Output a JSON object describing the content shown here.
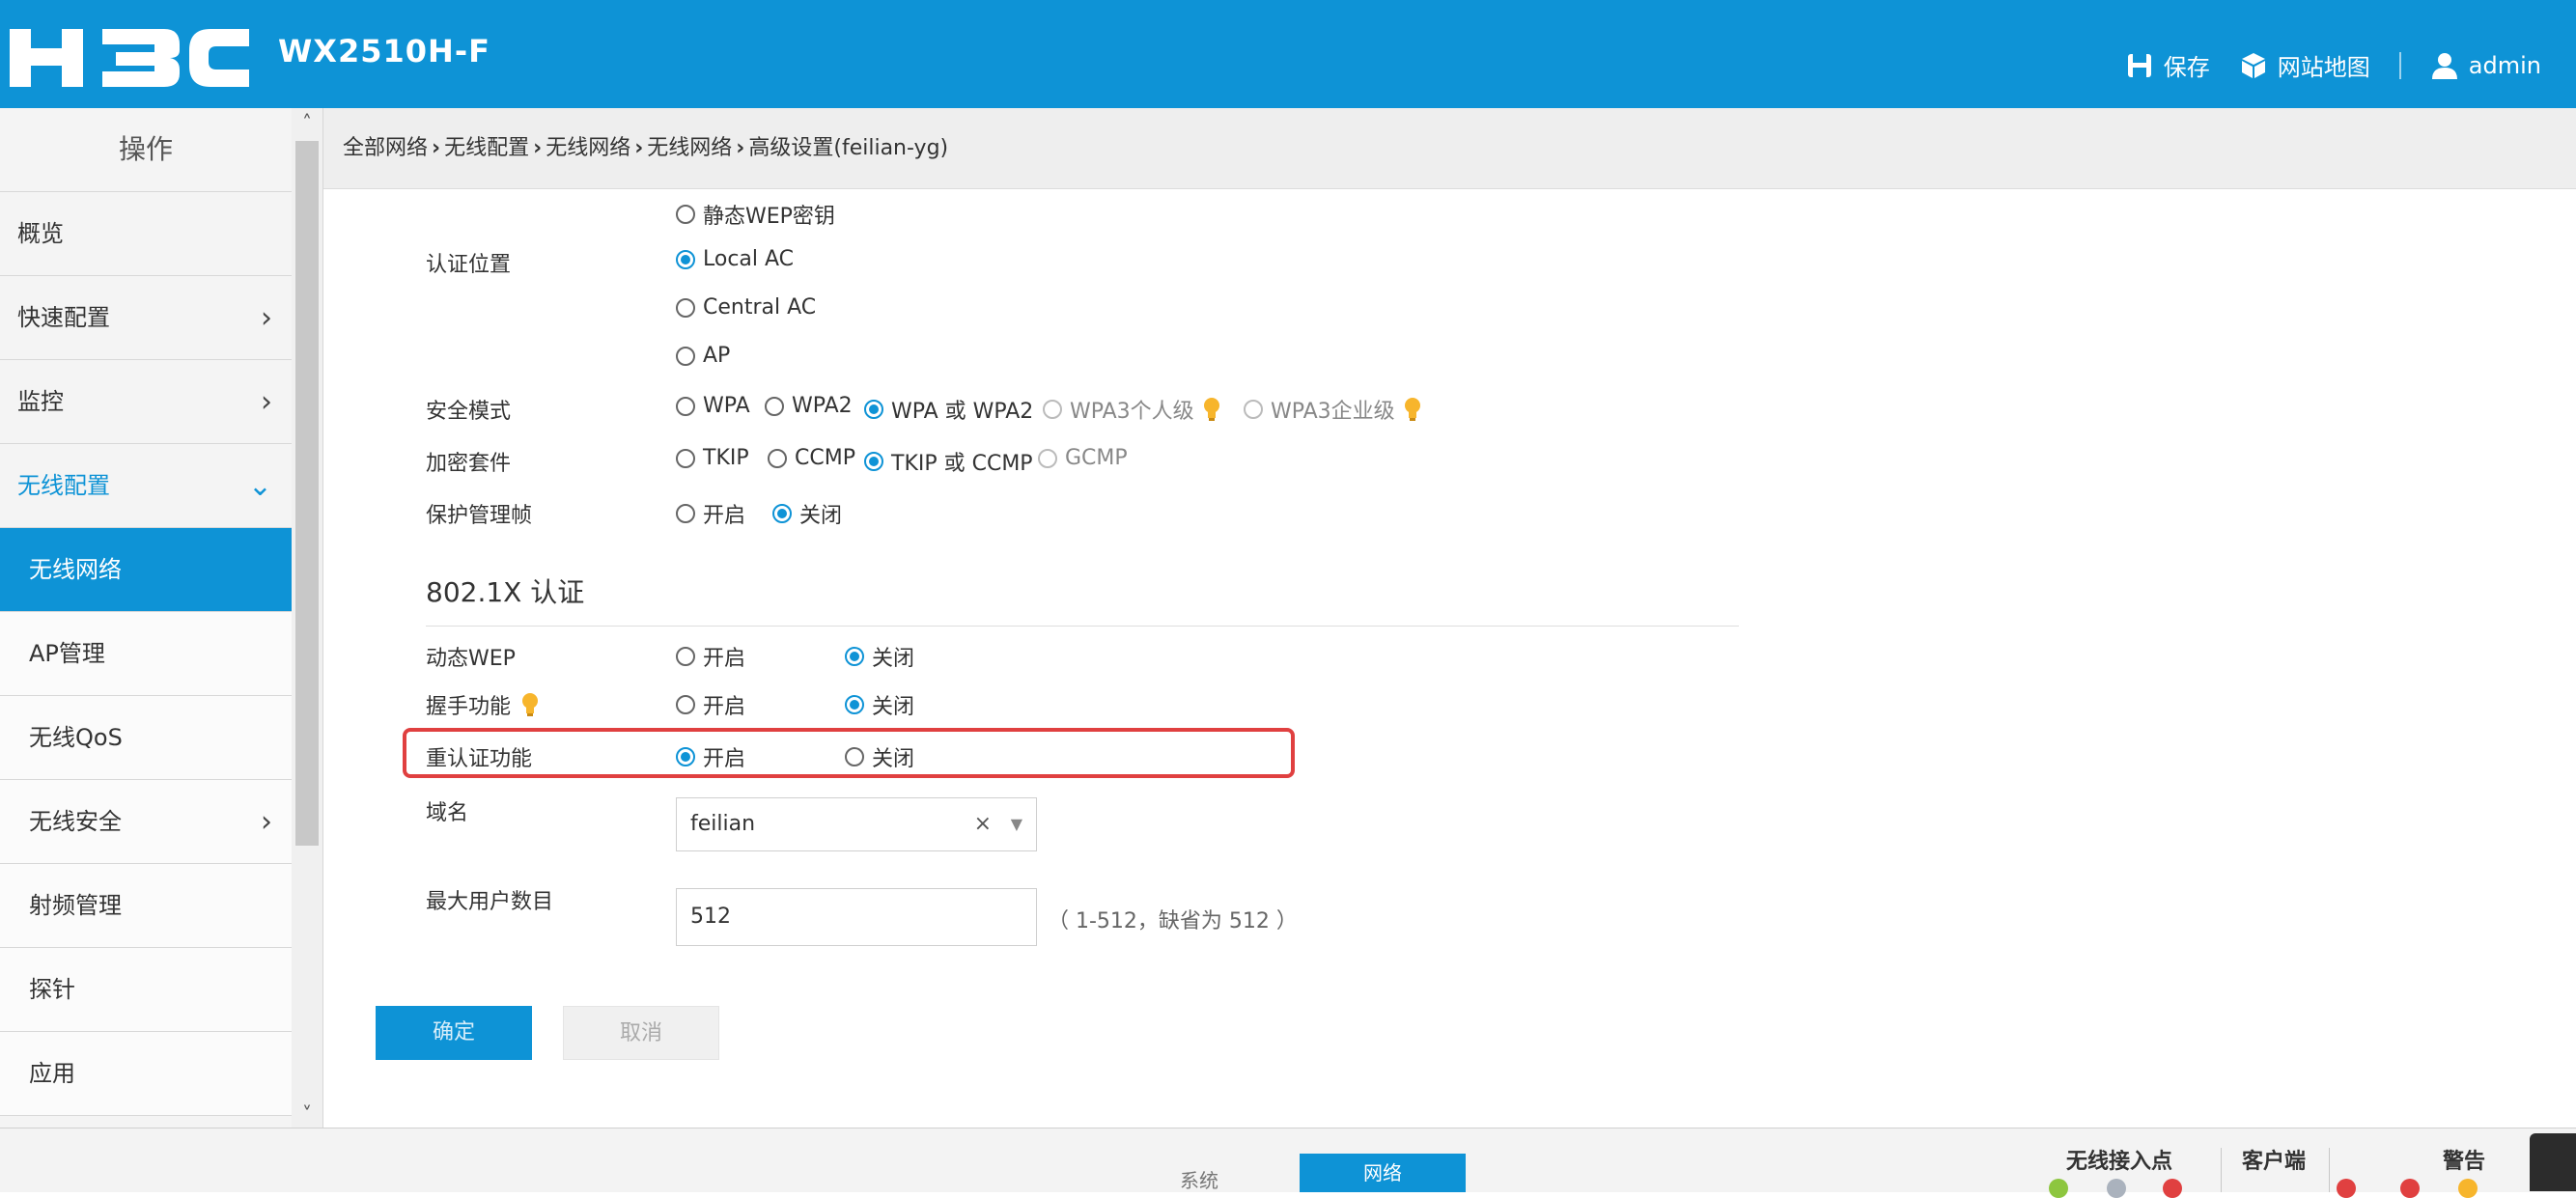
{
  "header": {
    "logo_text": "H3C",
    "model": "WX2510H-F",
    "save_label": "保存",
    "sitemap_label": "网站地图",
    "user_label": "admin"
  },
  "sidebar": {
    "title": "操作",
    "items": [
      {
        "label": "概览"
      },
      {
        "label": "快速配置"
      },
      {
        "label": "监控"
      },
      {
        "label": "无线配置"
      },
      {
        "label": "无线网络"
      },
      {
        "label": "AP管理"
      },
      {
        "label": "无线QoS"
      },
      {
        "label": "无线安全"
      },
      {
        "label": "射频管理"
      },
      {
        "label": "探针"
      },
      {
        "label": "应用"
      }
    ]
  },
  "breadcrumb": [
    "全部网络",
    "无线配置",
    "无线网络",
    "无线网络",
    "高级设置(feilian-yg)"
  ],
  "form": {
    "static_wep_option": "静态WEP密钥",
    "auth_location": {
      "label": "认证位置",
      "options": [
        "Local AC",
        "Central AC",
        "AP"
      ],
      "selected": "Local AC"
    },
    "security_mode": {
      "label": "安全模式",
      "options": [
        "WPA",
        "WPA2",
        "WPA 或 WPA2",
        "WPA3个人级",
        "WPA3企业级"
      ],
      "selected": "WPA 或 WPA2"
    },
    "cipher_suite": {
      "label": "加密套件",
      "options": [
        "TKIP",
        "CCMP",
        "TKIP 或 CCMP",
        "GCMP"
      ],
      "selected": "TKIP 或 CCMP"
    },
    "pmf": {
      "label": "保护管理帧",
      "on": "开启",
      "off": "关闭",
      "selected": "关闭"
    },
    "section_8021x": "802.1X 认证",
    "dynamic_wep": {
      "label": "动态WEP",
      "on": "开启",
      "off": "关闭",
      "selected": "关闭"
    },
    "handshake": {
      "label": "握手功能",
      "on": "开启",
      "off": "关闭",
      "selected": "关闭"
    },
    "reauth": {
      "label": "重认证功能",
      "on": "开启",
      "off": "关闭",
      "selected": "开启"
    },
    "domain": {
      "label": "域名",
      "value": "feilian"
    },
    "max_users": {
      "label": "最大用户数目",
      "value": "512",
      "hint": "（ 1-512，缺省为 512 ）"
    },
    "ok_label": "确定",
    "cancel_label": "取消"
  },
  "bottom": {
    "tab_system": "系统",
    "tab_network": "网络",
    "ap_label": "无线接入点",
    "client_label": "客户端",
    "alarm_label": "警告"
  },
  "colors": {
    "accent": "#0e93d6",
    "highlight": "#e04040"
  }
}
